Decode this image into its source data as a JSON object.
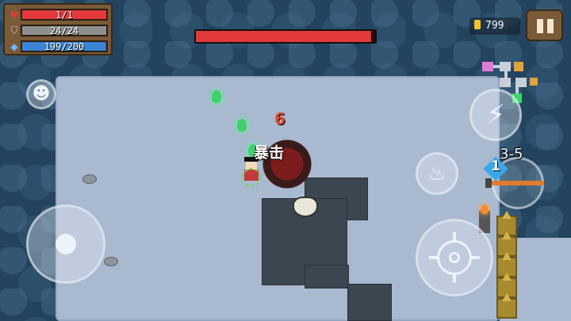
{
  "hud": {
    "health": {
      "icon": "heart-icon",
      "text": "1/1",
      "fraction": 1.0,
      "color": "#e23a3a"
    },
    "armor": {
      "icon": "shield-icon",
      "text": "24/24",
      "fraction": 1.0,
      "color": "#8f8f8f"
    },
    "energy": {
      "icon": "diamond-icon",
      "text": "199/200",
      "fraction": 0.995,
      "color": "#3a84d6"
    },
    "boss_health_fraction": 0.98,
    "coins": "799",
    "level": "3-5",
    "weapon_energy_cost": "1"
  },
  "combat": {
    "damage_label": "暴击",
    "damage_number": "6"
  },
  "controls": {
    "pause": "pause-icon",
    "emote": "smiley-icon",
    "skill": "lightning-icon",
    "swap": "swap-weapon-icon",
    "attack": "crosshair-icon"
  },
  "colors": {
    "floor": "#a9b9cf",
    "wall": "#23435e",
    "frame": "#7a5a37"
  }
}
